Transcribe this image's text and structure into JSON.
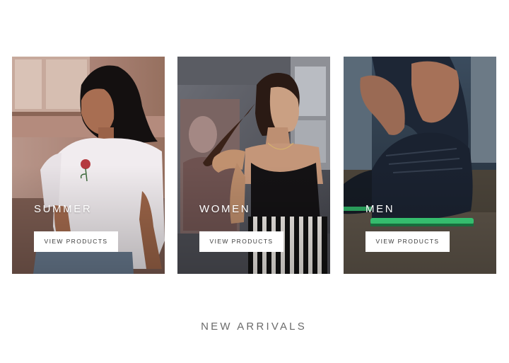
{
  "collections": [
    {
      "title": "SUMMER",
      "button_label": "VIEW PRODUCTS",
      "image": "woman-in-white-rose-tshirt-photo"
    },
    {
      "title": "WOMEN",
      "button_label": "VIEW PRODUCTS",
      "image": "woman-in-black-top-striped-pants-photo"
    },
    {
      "title": "MEN",
      "button_label": "VIEW PRODUCTS",
      "image": "man-tying-light-up-sneakers-photo"
    }
  ],
  "section": {
    "title": "NEW ARRIVALS"
  },
  "colors": {
    "background": "#ffffff",
    "button_background": "#ffffff",
    "button_text": "#3a3a3a",
    "card_title": "#ffffff",
    "section_title": "#6b6b6b"
  }
}
